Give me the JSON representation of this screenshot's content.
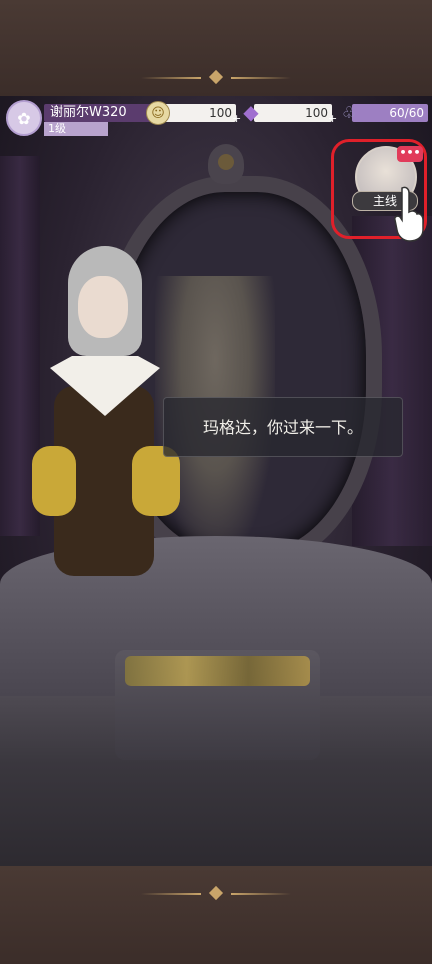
{
  "player": {
    "avatar_icon": "flower-avatar-icon",
    "name": "谢丽尔W320",
    "level": "1级"
  },
  "resources": {
    "coins": {
      "icon": "coin-icon",
      "value": "100"
    },
    "diamonds": {
      "icon": "diamond-icon",
      "value": "100"
    },
    "stamina": {
      "icon": "slipper-icon",
      "value": "60/60"
    }
  },
  "mainline": {
    "label": "主线",
    "badge": "•••",
    "pointer_icon": "hand-pointer-icon"
  },
  "dialog": {
    "text": "玛格达，你过来一下。"
  },
  "colors": {
    "accent": "#5b3c6e",
    "stamina": "#9d7fc2",
    "highlight": "#e0202a",
    "badge": "#e13b5a"
  }
}
